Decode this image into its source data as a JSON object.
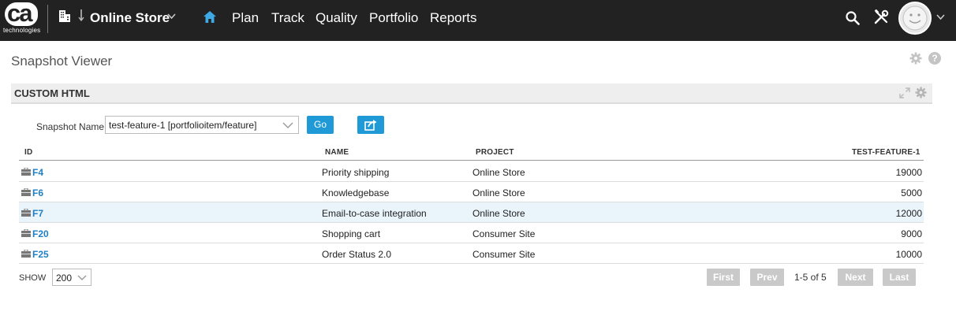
{
  "topbar": {
    "logo_text": "ca",
    "logo_subtext": "technologies",
    "workspace": "Online Store",
    "nav": [
      "Plan",
      "Track",
      "Quality",
      "Portfolio",
      "Reports"
    ],
    "icons": {
      "building": "building-icon",
      "arrow": "down-arrow-icon",
      "home": "home-icon",
      "search": "search-icon",
      "tools": "tools-icon",
      "avatar": "smiley-avatar"
    },
    "colors": {
      "bar": "#222222",
      "home_icon": "#3fa9e4"
    }
  },
  "page": {
    "title": "Snapshot Viewer"
  },
  "panel": {
    "title": "CUSTOM HTML",
    "snapshot_label": "Snapshot Name",
    "snapshot_value": "test-feature-1 [portfolioitem/feature]",
    "go_label": "Go",
    "accent": "#1f9ad6"
  },
  "table": {
    "columns": [
      "ID",
      "NAME",
      "PROJECT",
      "TEST-FEATURE-1"
    ],
    "rows": [
      {
        "id": "F4",
        "name": "Priority shipping",
        "project": "Online Store",
        "value": "19000"
      },
      {
        "id": "F6",
        "name": "Knowledgebase",
        "project": "Online Store",
        "value": "5000"
      },
      {
        "id": "F7",
        "name": "Email-to-case integration",
        "project": "Online Store",
        "value": "12000",
        "highlighted": true
      },
      {
        "id": "F20",
        "name": "Shopping cart",
        "project": "Consumer Site",
        "value": "9000"
      },
      {
        "id": "F25",
        "name": "Order Status 2.0",
        "project": "Consumer Site",
        "value": "10000"
      }
    ]
  },
  "footer": {
    "show_label": "SHOW",
    "show_value": "200",
    "first": "First",
    "prev": "Prev",
    "count": "1-5 of 5",
    "next": "Next",
    "last": "Last"
  }
}
